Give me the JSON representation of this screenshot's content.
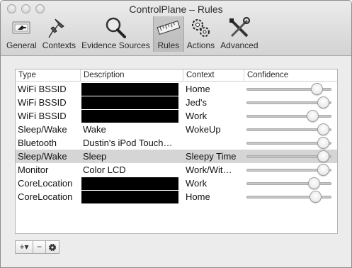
{
  "window": {
    "title": "ControlPlane – Rules"
  },
  "toolbar": {
    "items": [
      {
        "label": "General",
        "icon": "switch-icon"
      },
      {
        "label": "Contexts",
        "icon": "pushpin-icon"
      },
      {
        "label": "Evidence Sources",
        "icon": "magnifier-icon"
      },
      {
        "label": "Rules",
        "icon": "ruler-icon",
        "selected": true
      },
      {
        "label": "Actions",
        "icon": "gears-icon"
      },
      {
        "label": "Advanced",
        "icon": "tools-icon"
      }
    ]
  },
  "table": {
    "columns": [
      "Type",
      "Description",
      "Context",
      "Confidence"
    ],
    "rows": [
      {
        "type": "WiFi BSSID",
        "description": "",
        "context": "Home",
        "confidence": 0.88,
        "redacted": true
      },
      {
        "type": "WiFi BSSID",
        "description": "",
        "context": "Jed's",
        "confidence": 0.97,
        "redacted": true
      },
      {
        "type": "WiFi BSSID",
        "description": "",
        "context": "Work",
        "confidence": 0.83,
        "redacted": true
      },
      {
        "type": "Sleep/Wake",
        "description": "Wake",
        "context": "WokeUp",
        "confidence": 0.97
      },
      {
        "type": "Bluetooth",
        "description": "Dustin's iPod Touch…",
        "context": "",
        "confidence": 0.97
      },
      {
        "type": "Sleep/Wake",
        "description": "Sleep",
        "context": "Sleepy Time",
        "confidence": 0.97,
        "selected": true
      },
      {
        "type": "Monitor",
        "description": "Color LCD",
        "context": "Work/Wit…",
        "confidence": 0.97
      },
      {
        "type": "CoreLocation",
        "description": "..",
        "context": "Work",
        "confidence": 0.84,
        "redacted": true
      },
      {
        "type": "CoreLocation",
        "description": "..",
        "context": "Home",
        "confidence": 0.86,
        "redacted": true
      }
    ]
  },
  "buttons": {
    "add": "+▾",
    "remove": "−",
    "action_icon": "gear-icon"
  }
}
